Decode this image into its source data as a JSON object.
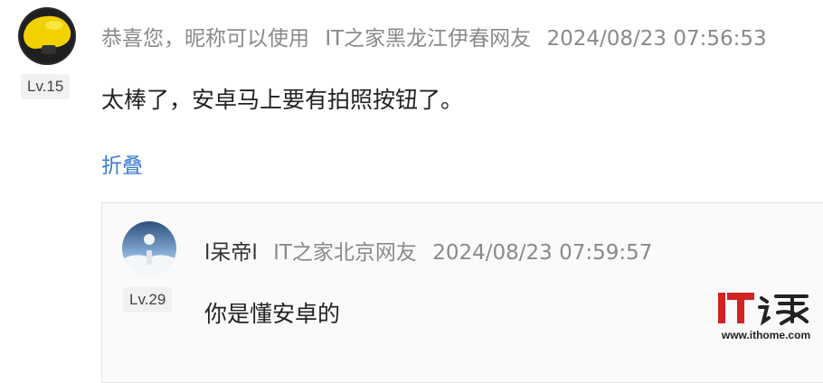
{
  "comment": {
    "level": "Lv.15",
    "nickname": "恭喜您，昵称可以使用",
    "location": "IT之家黑龙江伊春网友",
    "timestamp": "2024/08/23 07:56:53",
    "text": "太棒了，安卓马上要有拍照按钮了。",
    "fold_label": "折叠"
  },
  "reply": {
    "level": "Lv.29",
    "nickname": "l呆帝l",
    "location": "IT之家北京网友",
    "timestamp": "2024/08/23 07:59:57",
    "text": "你是懂安卓的"
  },
  "watermark": {
    "logo_text": "IT之家",
    "url": "www.ithome.com",
    "brand_color": "#d22222"
  }
}
